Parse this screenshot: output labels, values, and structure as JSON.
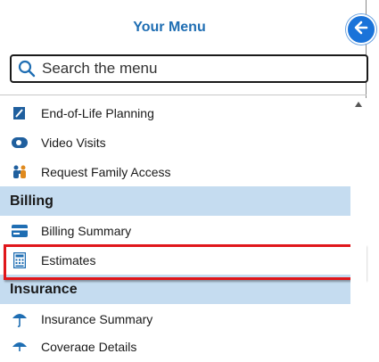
{
  "header": {
    "title": "Your Menu"
  },
  "search": {
    "placeholder": "Search the menu"
  },
  "items_top": [
    {
      "label": "End-of-Life Planning",
      "icon": "notebook-icon"
    },
    {
      "label": "Video Visits",
      "icon": "video-camera-icon"
    },
    {
      "label": "Request Family Access",
      "icon": "family-icon"
    }
  ],
  "billing": {
    "title": "Billing",
    "items": [
      {
        "label": "Billing Summary",
        "icon": "credit-card-icon"
      },
      {
        "label": "Estimates",
        "icon": "calculator-icon"
      }
    ]
  },
  "insurance": {
    "title": "Insurance",
    "items": [
      {
        "label": "Insurance Summary",
        "icon": "umbrella-icon"
      },
      {
        "label": "Coverage Details",
        "icon": "umbrella-icon"
      }
    ]
  },
  "colors": {
    "accent": "#1a73d9",
    "title": "#1f6eb3",
    "section_bg": "#c5dcf0",
    "highlight": "#e0161b"
  }
}
